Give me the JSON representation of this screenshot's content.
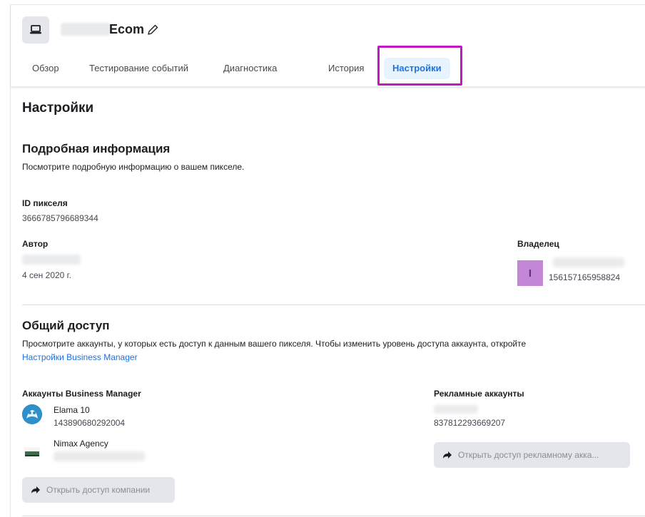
{
  "pixel": {
    "name": "Ecom"
  },
  "tabs": [
    {
      "label": "Обзор"
    },
    {
      "label": "Тестирование событий"
    },
    {
      "label": "Диагностика"
    },
    {
      "label": "История"
    },
    {
      "label": "Настройки"
    }
  ],
  "page_title": "Настройки",
  "details": {
    "heading": "Подробная информация",
    "description": "Посмотрите подробную информацию о вашем пикселе.",
    "pixel_id_label": "ID пикселя",
    "pixel_id_value": "3666785796689344",
    "author_label": "Автор",
    "author_date": "4 сен 2020 г.",
    "owner_label": "Владелец",
    "owner_initial": "I",
    "owner_id": "156157165958824"
  },
  "sharing": {
    "heading": "Общий доступ",
    "description": "Просмотрите аккаунты, у которых есть доступ к данным вашего пикселя. Чтобы изменить уровень доступа аккаунта, откройте",
    "link_text": "Настройки Business Manager",
    "bm_label": "Аккаунты Business Manager",
    "bm_accounts": [
      {
        "name": "Elama 10",
        "id": "143890680292004"
      },
      {
        "name": "Nimax Agency"
      }
    ],
    "ad_label": "Рекламные аккаунты",
    "ad_account_id": "837812293669207",
    "share_ad_button": "Открыть доступ рекламному акка...",
    "share_company_button": "Открыть доступ компании"
  },
  "colors": {
    "accent": "#1b74e4",
    "highlight": "#c019c4",
    "link": "#216fdb"
  }
}
